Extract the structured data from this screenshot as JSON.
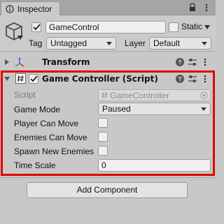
{
  "tab": {
    "title": "Inspector"
  },
  "header": {
    "name": "GameControl",
    "static_label": "Static",
    "tag_label": "Tag",
    "tag_value": "Untagged",
    "layer_label": "Layer",
    "layer_value": "Default"
  },
  "transform": {
    "title": "Transform"
  },
  "component": {
    "title": "Game Controller (Script)",
    "fields": {
      "script_label": "Script",
      "script_value": "GameController",
      "game_mode_label": "Game Mode",
      "game_mode_value": "Paused",
      "player_move_label": "Player Can Move",
      "enemies_move_label": "Enemies Can Move",
      "spawn_label": "Spawn New Enemies",
      "time_scale_label": "Time Scale",
      "time_scale_value": "0"
    }
  },
  "add_component_label": "Add Component",
  "colors": {
    "highlight": "#e00000",
    "panel": "#c8c8c8",
    "tabbar": "#a5a5a5"
  },
  "icons": [
    "info-icon",
    "lock-icon",
    "menu-icon",
    "gameobject-cube-icon",
    "help-icon",
    "preset-sliders-icon",
    "transform-axis-icon",
    "script-hash-icon",
    "object-picker-icon"
  ]
}
